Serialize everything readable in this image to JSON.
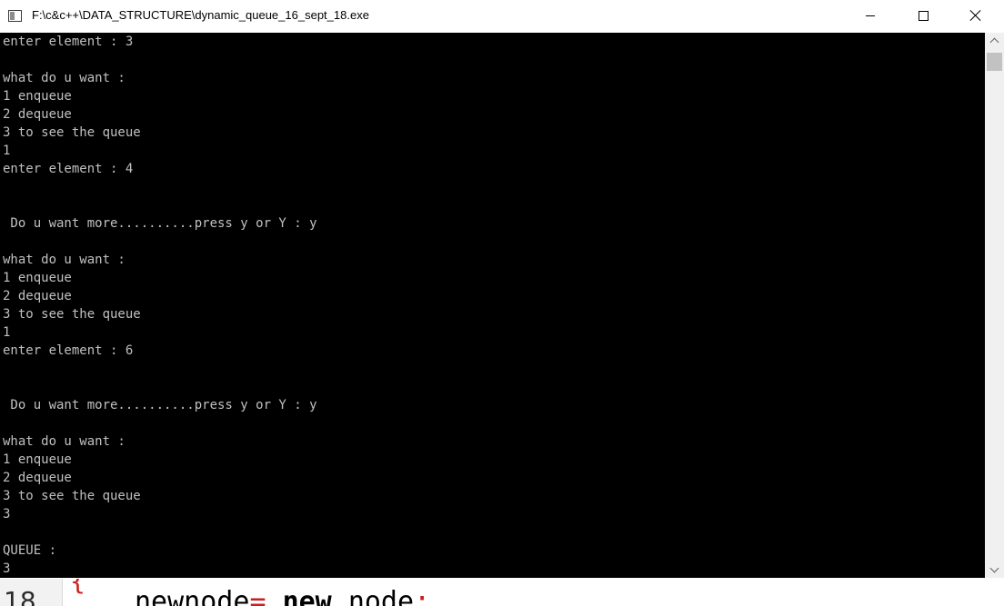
{
  "window": {
    "title": "F:\\c&c++\\DATA_STRUCTURE\\dynamic_queue_16_sept_18.exe",
    "icon": "console-app-icon",
    "controls": {
      "minimize": "minimize-icon",
      "maximize": "maximize-icon",
      "close": "close-icon"
    }
  },
  "console": {
    "background": "#000000",
    "text_color": "#c0c0c0",
    "lines": [
      "enter element : 3",
      "",
      "what do u want :",
      "1 enqueue",
      "2 dequeue",
      "3 to see the queue",
      "1",
      "enter element : 4",
      "",
      "",
      " Do u want more..........press y or Y : y",
      "",
      "what do u want :",
      "1 enqueue",
      "2 dequeue",
      "3 to see the queue",
      "1",
      "enter element : 6",
      "",
      "",
      " Do u want more..........press y or Y : y",
      "",
      "what do u want :",
      "1 enqueue",
      "2 dequeue",
      "3 to see the queue",
      "3",
      "",
      "QUEUE :",
      "3"
    ]
  },
  "scrollbar": {
    "up_icon": "chevron-up-icon",
    "down_icon": "chevron-down-icon"
  },
  "editor_behind": {
    "line_number": "18",
    "brace": "{",
    "code": {
      "lhs": "newnode",
      "op": "=",
      "kw": "new",
      "rhs": "node",
      "end": ";"
    }
  }
}
